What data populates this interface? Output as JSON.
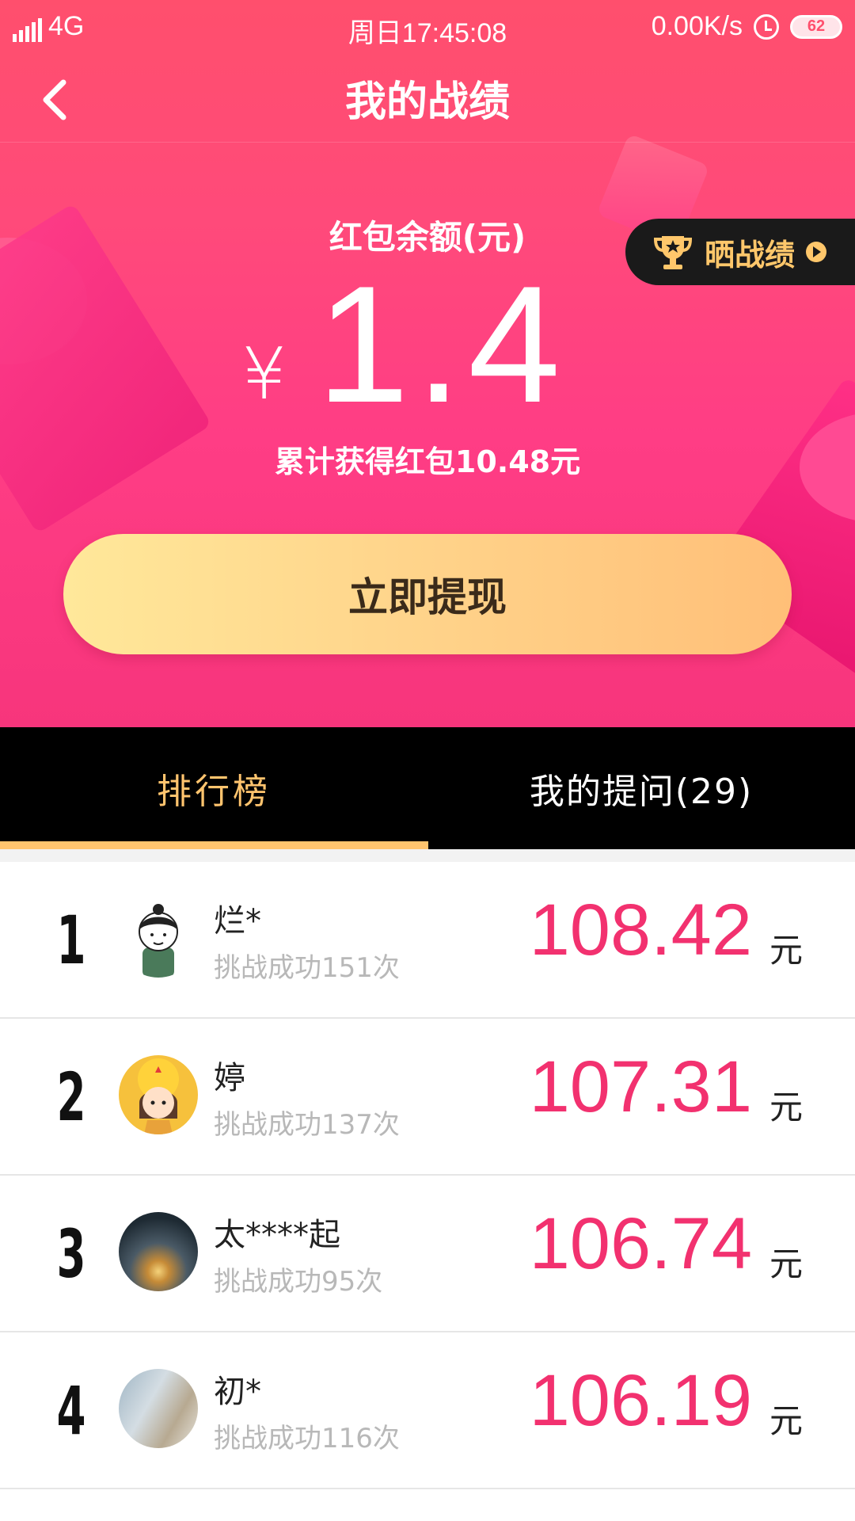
{
  "status_bar": {
    "network": "4G",
    "time": "周日17:45:08",
    "speed": "0.00K/s",
    "battery": "62"
  },
  "nav": {
    "title": "我的战绩"
  },
  "balance": {
    "title": "红包余额(元)",
    "currency": "¥",
    "amount": "1.4",
    "total_text": "累计获得红包10.48元"
  },
  "show_button": {
    "label": "晒战绩"
  },
  "withdraw_button": {
    "label": "立即提现"
  },
  "tabs": [
    {
      "label": "排行榜",
      "active": true
    },
    {
      "label": "我的提问(29)",
      "active": false
    }
  ],
  "colors": {
    "accent_pink": "#f2316f",
    "tab_gold": "#ffc46e"
  },
  "ranking": [
    {
      "rank": "1",
      "name": "烂*",
      "challenges": "挑战成功151次",
      "amount": "108.42",
      "unit": "元"
    },
    {
      "rank": "2",
      "name": "婷",
      "challenges": "挑战成功137次",
      "amount": "107.31",
      "unit": "元"
    },
    {
      "rank": "3",
      "name": "太****起",
      "challenges": "挑战成功95次",
      "amount": "106.74",
      "unit": "元"
    },
    {
      "rank": "4",
      "name": "初*",
      "challenges": "挑战成功116次",
      "amount": "106.19",
      "unit": "元"
    }
  ]
}
